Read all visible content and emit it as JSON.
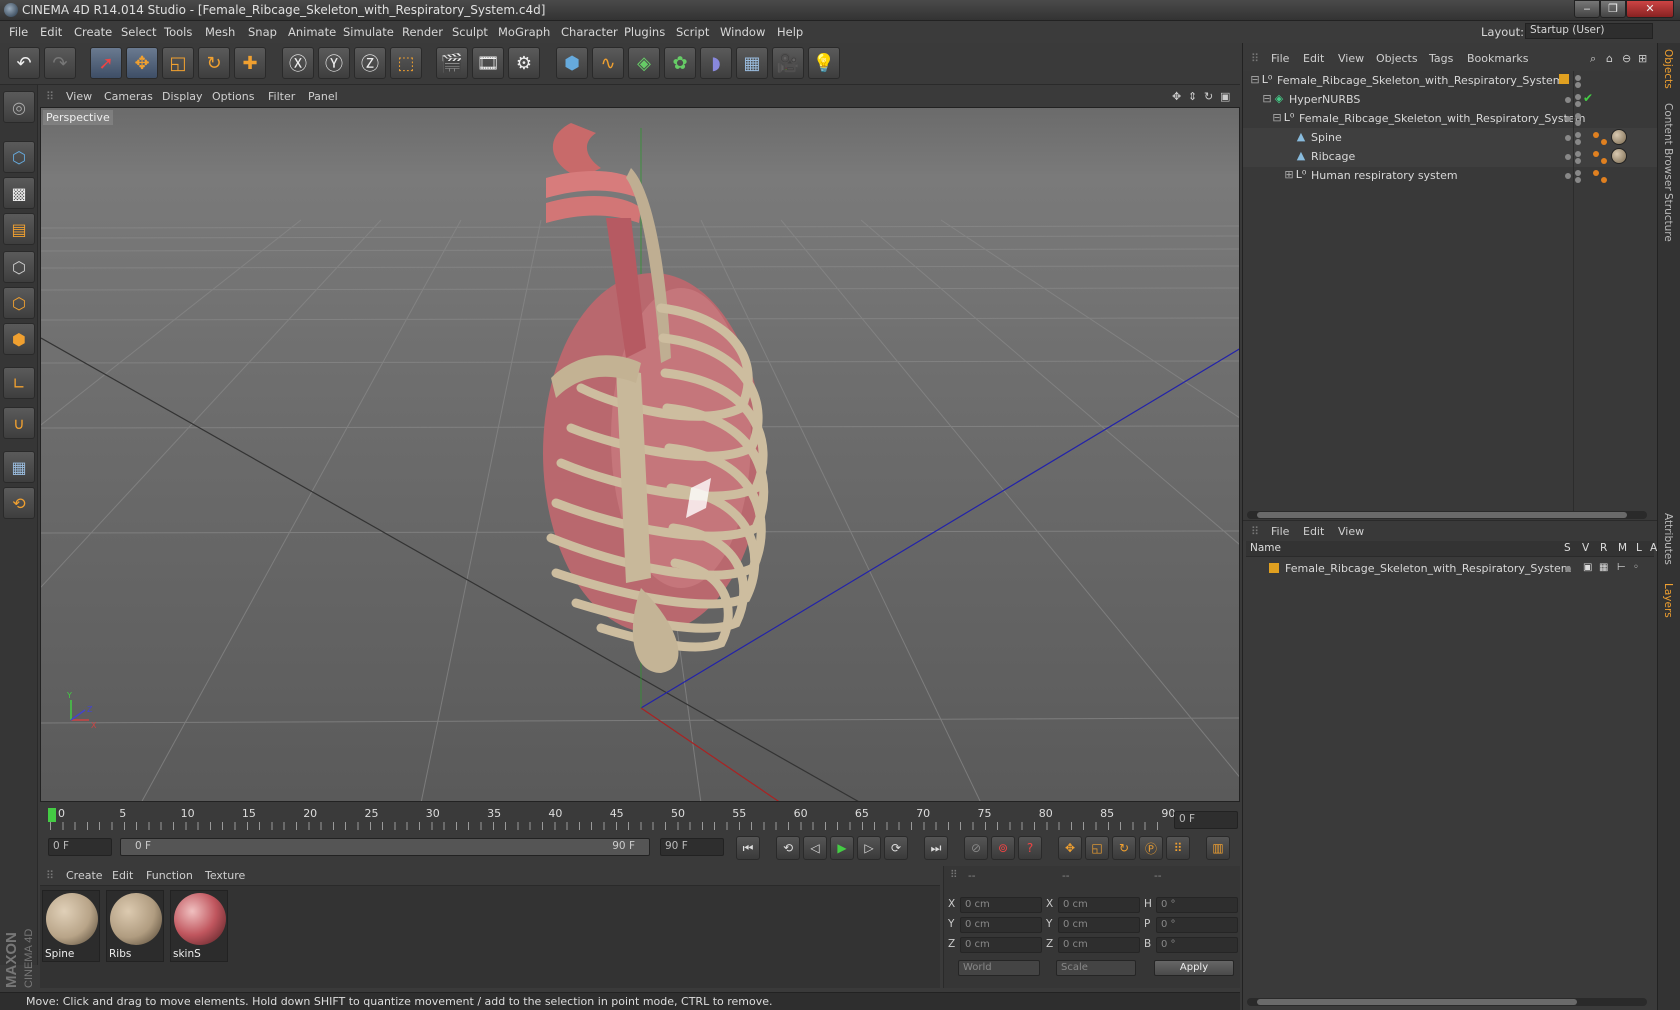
{
  "window": {
    "title": "CINEMA 4D R14.014 Studio - [Female_Ribcage_Skeleton_with_Respiratory_System.c4d]",
    "layout_label": "Layout:",
    "layout_value": "Startup (User)"
  },
  "menu": [
    "File",
    "Edit",
    "Create",
    "Select",
    "Tools",
    "Mesh",
    "Snap",
    "Animate",
    "Simulate",
    "Render",
    "Sculpt",
    "MoGraph",
    "Character",
    "Plugins",
    "Script",
    "Window",
    "Help"
  ],
  "viewport": {
    "menu": [
      "View",
      "Cameras",
      "Display",
      "Options",
      "Filter",
      "Panel"
    ],
    "label": "Perspective",
    "axis_y": "Y",
    "axis_z": "Z",
    "axis_x": "X"
  },
  "timeline": {
    "ticks": [
      "0",
      "5",
      "10",
      "15",
      "20",
      "25",
      "30",
      "35",
      "40",
      "45",
      "50",
      "55",
      "60",
      "65",
      "70",
      "75",
      "80",
      "85",
      "90"
    ],
    "current_frame": "0 F",
    "start": "0 F",
    "range_start": "0 F",
    "range_end": "90 F",
    "end": "90 F"
  },
  "materials": {
    "menu": [
      "Create",
      "Edit",
      "Function",
      "Texture"
    ],
    "items": [
      {
        "name": "Spine",
        "color": "#b8a488"
      },
      {
        "name": "Ribs",
        "color": "#b09c80"
      },
      {
        "name": "skinS",
        "color": "#c0565e"
      }
    ]
  },
  "coordinates": {
    "header": [
      "--",
      "--",
      "--"
    ],
    "rows": [
      {
        "l1": "X",
        "v1": "0 cm",
        "l2": "X",
        "v2": "0 cm",
        "l3": "H",
        "v3": "0 °"
      },
      {
        "l1": "Y",
        "v1": "0 cm",
        "l2": "Y",
        "v2": "0 cm",
        "l3": "P",
        "v3": "0 °"
      },
      {
        "l1": "Z",
        "v1": "0 cm",
        "l2": "Z",
        "v2": "0 cm",
        "l3": "B",
        "v3": "0 °"
      }
    ],
    "mode": "World",
    "transform": "Scale",
    "apply": "Apply"
  },
  "status": "Move: Click and drag to move elements. Hold down SHIFT to quantize movement / add to the selection in point mode, CTRL to remove.",
  "objects": {
    "menu": [
      "File",
      "Edit",
      "View",
      "Objects",
      "Tags",
      "Bookmarks"
    ],
    "items": [
      {
        "name": "Female_Ribcage_Skeleton_with_Respiratory_System"
      },
      {
        "name": "HyperNURBS"
      },
      {
        "name": "Female_Ribcage_Skeleton_with_Respiratory_System"
      },
      {
        "name": "Spine"
      },
      {
        "name": "Ribcage"
      },
      {
        "name": "Human respiratory system"
      }
    ]
  },
  "layers": {
    "menu": [
      "File",
      "Edit",
      "View"
    ],
    "columns": [
      "Name",
      "S",
      "V",
      "R",
      "M",
      "L",
      "A"
    ],
    "items": [
      {
        "name": "Female_Ribcage_Skeleton_with_Respiratory_System"
      }
    ]
  },
  "side_tabs": [
    "Objects",
    "Content Browser",
    "Structure",
    "Attributes",
    "Layers"
  ],
  "branding": {
    "maxon": "MAXON",
    "c4d": "CINEMA 4D"
  },
  "colors": {
    "accent": "#f0a030",
    "selection": "#5a6e8c",
    "bone": "#c8b89a",
    "lung": "#b8606a"
  }
}
